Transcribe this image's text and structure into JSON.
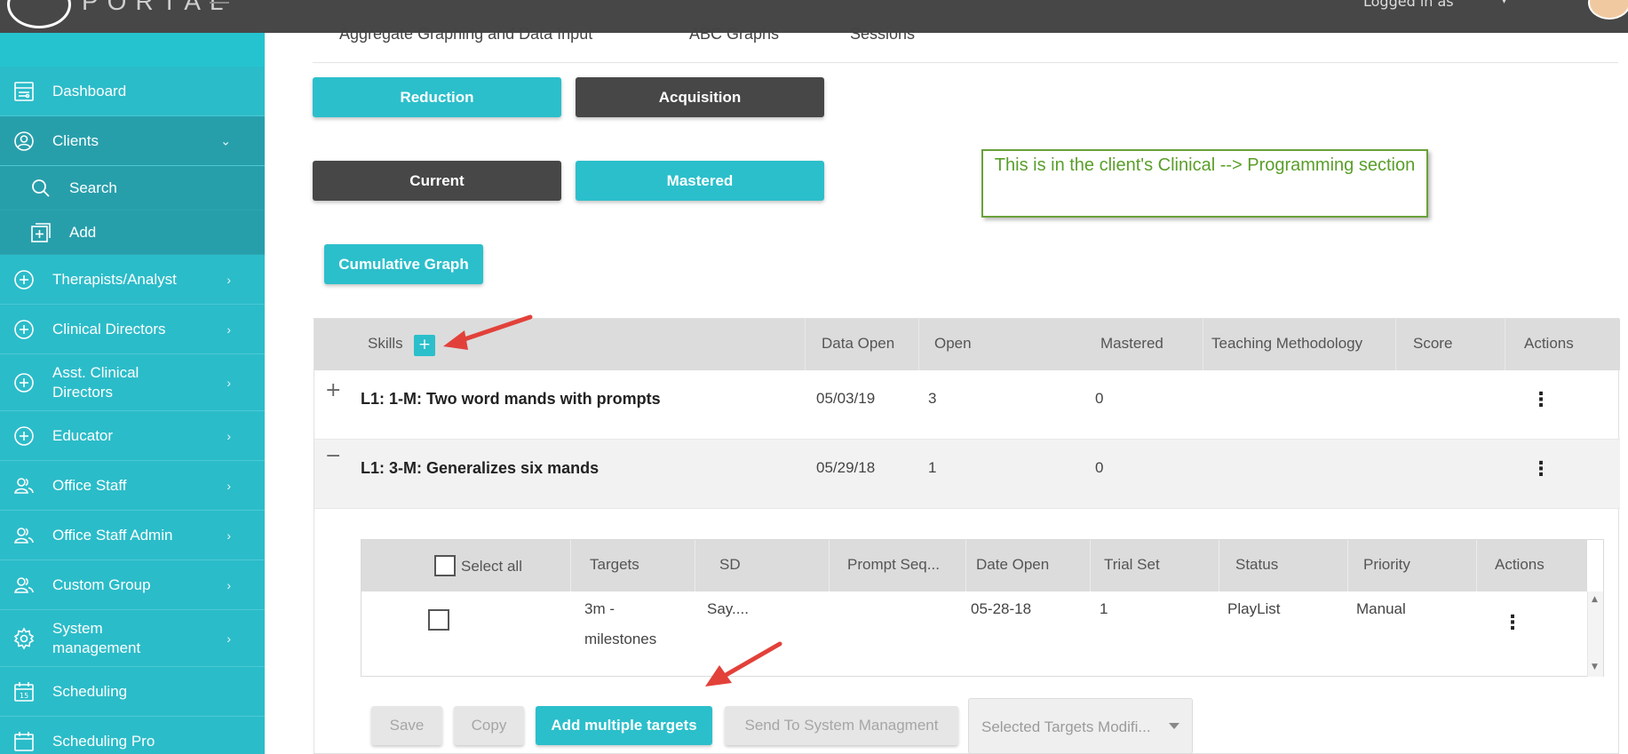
{
  "topbar": {
    "logo_text": "PORTAL",
    "user_text": "Logged in as",
    "caret": "▾"
  },
  "sidebar": {
    "items": [
      {
        "label": "Dashboard",
        "icon": "dashboard-icon"
      },
      {
        "label": "Clients",
        "icon": "user-circle-icon",
        "chevron": "⌄"
      },
      {
        "label": "Search",
        "icon": "search-icon"
      },
      {
        "label": "Add",
        "icon": "add-square-icon"
      },
      {
        "label": "Therapists/Analyst",
        "icon": "plus-circle-icon",
        "chevron": "›"
      },
      {
        "label": "Clinical Directors",
        "icon": "plus-circle-icon",
        "chevron": "›"
      },
      {
        "label": "Asst. Clinical Directors",
        "icon": "plus-circle-icon",
        "chevron": "›"
      },
      {
        "label": "Educator",
        "icon": "plus-circle-icon",
        "chevron": "›"
      },
      {
        "label": "Office Staff",
        "icon": "users-icon",
        "chevron": "›"
      },
      {
        "label": "Office Staff Admin",
        "icon": "users-icon",
        "chevron": "›"
      },
      {
        "label": "Custom Group",
        "icon": "users-icon",
        "chevron": "›"
      },
      {
        "label": "System management",
        "icon": "gear-icon",
        "chevron": "›"
      },
      {
        "label": "Scheduling",
        "icon": "calendar-icon"
      },
      {
        "label": "Scheduling Pro",
        "icon": "calendar-icon"
      }
    ]
  },
  "tabs": [
    "Aggregate Graphing and Data Input",
    "ABC Graphs",
    "Sessions"
  ],
  "buttons": {
    "reduction": "Reduction",
    "acquisition": "Acquisition",
    "current": "Current",
    "mastered": "Mastered",
    "cumulative_graph": "Cumulative Graph"
  },
  "note": "This is in the client's Clinical --> Programming section",
  "skills_table": {
    "headers": [
      "Skills",
      "Data Open",
      "Open",
      "Mastered",
      "Teaching Methodology",
      "Score",
      "Actions"
    ],
    "add_label": "+",
    "rows": [
      {
        "toggle": "+",
        "title": "L1: 1-M: Two word mands with prompts",
        "data_open": "05/03/19",
        "open": "3",
        "mastered": "0",
        "kebab": "⋮"
      },
      {
        "toggle": "−",
        "title": "L1: 3-M: Generalizes six mands",
        "data_open": "05/29/18",
        "open": "1",
        "mastered": "0",
        "kebab": "⋮"
      }
    ]
  },
  "targets_table": {
    "select_all": "Select all",
    "headers": [
      "Targets",
      "SD",
      "Prompt Seq...",
      "Date Open",
      "Trial Set",
      "Status",
      "Priority",
      "Actions"
    ],
    "row": {
      "target_line1": "3m -",
      "target_line2": "milestones",
      "sd": "Say....",
      "prompt_seq": "",
      "date_open": "05-28-18",
      "trial_set": "1",
      "status": "PlayList",
      "priority": "Manual",
      "kebab": "⋮"
    },
    "scroll_up": "▲",
    "scroll_down": "▼"
  },
  "actions": {
    "save": "Save",
    "copy": "Copy",
    "add_multiple": "Add multiple targets",
    "send_to": "Send To System Managment",
    "selected_modifier": "Selected Targets Modifi..."
  },
  "colors": {
    "teal": "#2bbfcb",
    "dark": "#474747",
    "note_green": "#6aa03a",
    "arrow_red": "#e2413a"
  }
}
